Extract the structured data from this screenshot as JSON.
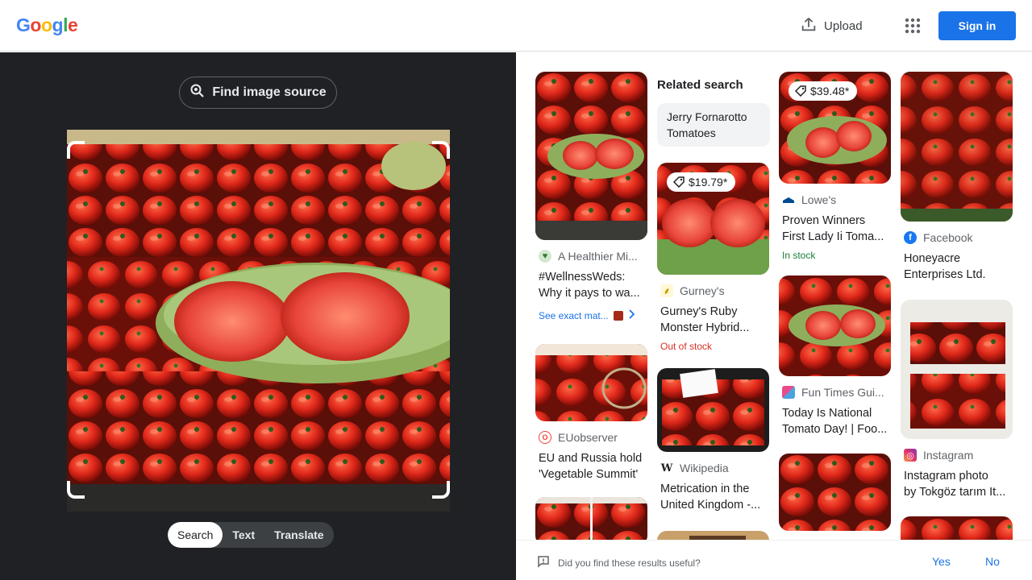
{
  "header": {
    "logo_letters": [
      "G",
      "o",
      "o",
      "g",
      "l",
      "e"
    ],
    "upload_label": "Upload",
    "signin_label": "Sign in"
  },
  "left": {
    "find_source_label": "Find image source",
    "modes": [
      "Search",
      "Text",
      "Translate"
    ]
  },
  "related": {
    "label": "Related search",
    "chip": "Jerry Fornarotto Tomatoes"
  },
  "results": [
    {
      "source": "A Healthier Mi...",
      "title": [
        "#WellnessWeds:",
        "Why it pays to wa..."
      ],
      "exact_label": "See exact mat..."
    },
    {
      "source": "EUobserver",
      "title": [
        "EU and Russia hold",
        "'Vegetable Summit'"
      ]
    },
    {
      "price": "$19.79*",
      "source": "Gurney's",
      "title": [
        "Gurney's Ruby",
        "Monster Hybrid..."
      ],
      "status": "Out of stock"
    },
    {
      "source": "Wikipedia",
      "title": [
        "Metrication in the",
        "United Kingdom -..."
      ]
    },
    {
      "price": "$39.48*",
      "source": "Lowe's",
      "title": [
        "Proven Winners",
        "First Lady Ii Toma..."
      ],
      "status": "In stock"
    },
    {
      "source": "Fun Times Gui...",
      "title": [
        "Today Is National",
        "Tomato Day! | Foo..."
      ]
    },
    {
      "source": "Facebook",
      "title": [
        "Honeyacre",
        "Enterprises Ltd."
      ]
    },
    {
      "source": "Instagram",
      "title": [
        "Instagram photo",
        "by Tokgöz tarım It..."
      ]
    }
  ],
  "feedback": {
    "question": "Did you find these results useful?",
    "yes": "Yes",
    "no": "No"
  },
  "colors": {
    "accent": "#1a73e8",
    "in_stock": "#188038",
    "out_of_stock": "#d93025",
    "dark_panel": "#202124"
  }
}
